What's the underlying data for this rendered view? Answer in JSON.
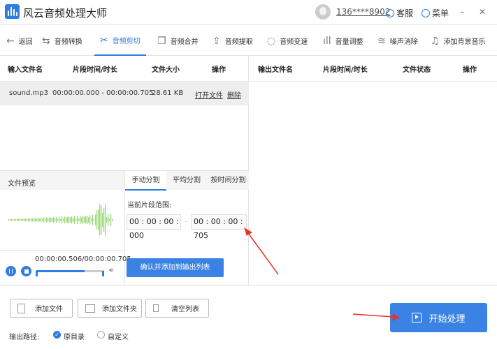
{
  "app": {
    "title": "风云音频处理大师",
    "phone": "136****8902",
    "service": "客服",
    "menu": "菜单",
    "minimize": "–",
    "close": "✕"
  },
  "nav": {
    "back": "返回",
    "items": [
      "音频转换",
      "音频剪切",
      "音频合并",
      "音频提取",
      "音频变速",
      "音量调整",
      "噪声消除",
      "添加背景音乐"
    ],
    "active": 1
  },
  "input_table": {
    "headers": [
      "输入文件名",
      "片段时间/时长",
      "文件大小",
      "操作"
    ],
    "rows": [
      {
        "name": "sound.mp3",
        "range": "00:00:00.000 - 00:00:00.705",
        "size": "28.61 KB",
        "open": "打开文件",
        "delete": "删除"
      }
    ]
  },
  "output_table": {
    "headers": [
      "输出文件名",
      "片段时间/时长",
      "文件状态",
      "操作"
    ]
  },
  "preview": {
    "title": "文件预览",
    "time": "00:00:00.506/00:00:00.705",
    "progress": 0.72
  },
  "split": {
    "tabs": [
      "手动分割",
      "平均分割",
      "按时间分割"
    ],
    "range_label": "当前片段范围:",
    "start": "00 : 00 : 00 : 000",
    "end": "00 : 00 : 00 : 705",
    "confirm": "确认并添加到输出列表"
  },
  "bottom": {
    "add_file": "添加文件",
    "add_folder": "添加文件夹",
    "clear": "清空列表",
    "path_label": "输出路径:",
    "opt_original": "原目录",
    "opt_custom": "自定义",
    "start": "开始处理"
  },
  "colors": {
    "accent": "#2f7de1",
    "arrow": "#e8312a"
  }
}
